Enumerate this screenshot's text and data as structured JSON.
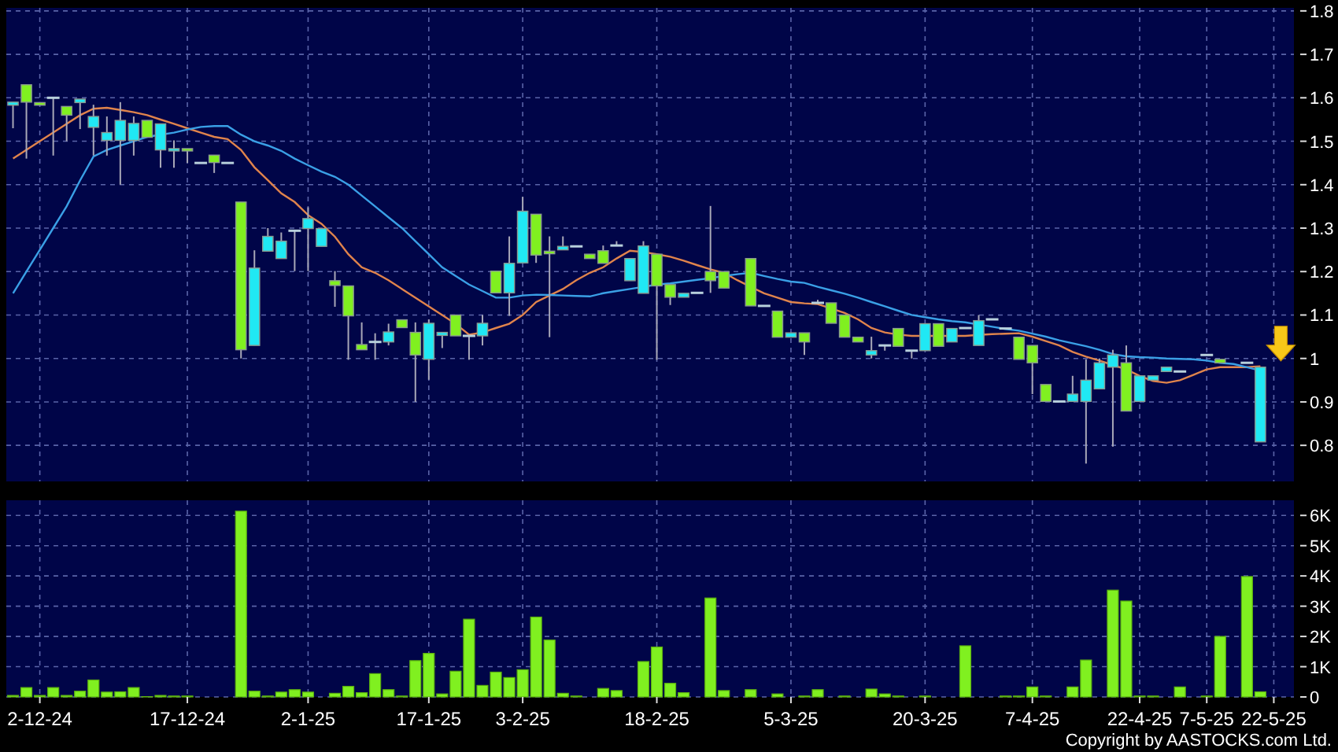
{
  "price_chart": {
    "chart_data": {
      "type": "candlestick",
      "grid": true,
      "ylim": [
        0.717,
        1.807
      ],
      "yticks": [
        0.8,
        0.9,
        1,
        1.1,
        1.2,
        1.3,
        1.4,
        1.5,
        1.6,
        1.7,
        1.8
      ],
      "categories": [
        null,
        null,
        null,
        null,
        null,
        null,
        null,
        null,
        null,
        null,
        null,
        null,
        null,
        null,
        null,
        null,
        null,
        null,
        null,
        null,
        null,
        null,
        null,
        null,
        null,
        null,
        null,
        null,
        null,
        null,
        null,
        null,
        null,
        null,
        null,
        null,
        null,
        null,
        null,
        null,
        null,
        null,
        null,
        null,
        null,
        null,
        null,
        null,
        null,
        null,
        null,
        null,
        null,
        null,
        null,
        null,
        null,
        null,
        null,
        null,
        null,
        null,
        null,
        null,
        null,
        null,
        null,
        null,
        null,
        null,
        null,
        null,
        null,
        null,
        null,
        null,
        null,
        null,
        null,
        null,
        null,
        null,
        null,
        null,
        null,
        null,
        null,
        null,
        null,
        null,
        null,
        null,
        null,
        null,
        null,
        null
      ],
      "ohlc": [
        [
          1.59,
          1.59,
          1.53,
          1.583
        ],
        [
          1.59,
          1.63,
          1.46,
          1.63
        ],
        [
          1.583,
          1.59,
          1.583,
          1.589
        ],
        [
          1.6,
          1.6,
          1.467,
          1.6
        ],
        [
          1.56,
          1.58,
          1.5,
          1.58
        ],
        [
          1.597,
          1.597,
          1.528,
          1.589
        ],
        [
          1.557,
          1.584,
          1.467,
          1.532
        ],
        [
          1.52,
          1.557,
          1.467,
          1.502
        ],
        [
          1.548,
          1.59,
          1.4,
          1.502
        ],
        [
          1.541,
          1.557,
          1.467,
          1.502
        ],
        [
          1.509,
          1.548,
          1.509,
          1.548
        ],
        [
          1.54,
          1.54,
          1.439,
          1.48
        ],
        [
          1.483,
          1.502,
          1.439,
          1.48
        ],
        [
          1.48,
          1.483,
          1.45,
          1.483
        ],
        [
          1.45,
          1.45,
          1.45,
          1.45
        ],
        [
          1.451,
          1.468,
          1.427,
          1.468
        ],
        [
          1.45,
          1.45,
          1.45,
          1.45
        ],
        [
          1.02,
          1.36,
          1,
          1.36
        ],
        [
          1.208,
          1.249,
          1.03,
          1.03
        ],
        [
          1.281,
          1.3,
          1.247,
          1.247
        ],
        [
          1.27,
          1.29,
          1.23,
          1.23
        ],
        [
          1.294,
          1.294,
          1.201,
          1.294
        ],
        [
          1.322,
          1.348,
          1.201,
          1.299
        ],
        [
          1.299,
          1.299,
          1.258,
          1.258
        ],
        [
          1.168,
          1.201,
          1.119,
          1.179
        ],
        [
          1.098,
          1.167,
          0.997,
          1.167
        ],
        [
          1.02,
          1.083,
          1.02,
          1.032
        ],
        [
          1.038,
          1.058,
          0.997,
          1.038
        ],
        [
          1.061,
          1.08,
          1.03,
          1.038
        ],
        [
          1.071,
          1.089,
          1.071,
          1.089
        ],
        [
          1.008,
          1.083,
          0.9,
          1.06
        ],
        [
          1.081,
          1.09,
          0.951,
          0.998
        ],
        [
          1.06,
          1.06,
          1.024,
          1.053
        ],
        [
          1.052,
          1.1,
          1.052,
          1.1
        ],
        [
          1.052,
          1.052,
          0.997,
          1.052
        ],
        [
          1.081,
          1.1,
          1.03,
          1.052
        ],
        [
          1.151,
          1.201,
          1.151,
          1.201
        ],
        [
          1.219,
          1.281,
          1.098,
          1.151
        ],
        [
          1.339,
          1.372,
          1.22,
          1.22
        ],
        [
          1.238,
          1.332,
          1.22,
          1.332
        ],
        [
          1.241,
          1.281,
          1.049,
          1.247
        ],
        [
          1.258,
          1.281,
          1.25,
          1.25
        ],
        [
          1.258,
          1.258,
          1.258,
          1.258
        ],
        [
          1.23,
          1.24,
          1.23,
          1.24
        ],
        [
          1.219,
          1.26,
          1.219,
          1.248
        ],
        [
          1.26,
          1.27,
          1.26,
          1.26
        ],
        [
          1.23,
          1.23,
          1.179,
          1.179
        ],
        [
          1.259,
          1.27,
          1.15,
          1.15
        ],
        [
          1.167,
          1.24,
          0.997,
          1.24
        ],
        [
          1.141,
          1.17,
          1.123,
          1.17
        ],
        [
          1.15,
          1.15,
          1.141,
          1.141
        ],
        [
          1.151,
          1.151,
          1.151,
          1.151
        ],
        [
          1.179,
          1.351,
          1.151,
          1.2
        ],
        [
          1.162,
          1.2,
          1.162,
          1.2
        ],
        null,
        [
          1.121,
          1.23,
          1.121,
          1.23
        ],
        [
          1.121,
          1.121,
          1.121,
          1.121
        ],
        [
          1.049,
          1.109,
          1.049,
          1.109
        ],
        [
          1.059,
          1.059,
          1.049,
          1.049
        ],
        [
          1.038,
          1.059,
          1.008,
          1.059
        ],
        [
          1.128,
          1.135,
          1.128,
          1.128
        ],
        [
          1.081,
          1.128,
          1.081,
          1.128
        ],
        [
          1.049,
          1.1,
          1.049,
          1.1
        ],
        [
          1.038,
          1.049,
          1.038,
          1.049
        ],
        [
          1.018,
          1.05,
          1,
          1.008
        ],
        [
          1.03,
          1.03,
          1.018,
          1.03
        ],
        [
          1.028,
          1.069,
          1.028,
          1.069
        ],
        [
          1.018,
          1.018,
          1,
          1.018
        ],
        [
          1.08,
          1.08,
          1.018,
          1.018
        ],
        [
          1.028,
          1.08,
          1.028,
          1.08
        ],
        [
          1.069,
          1.069,
          1.038,
          1.038
        ],
        [
          1.07,
          1.07,
          1.07,
          1.07
        ],
        [
          1.087,
          1.1,
          1.03,
          1.03
        ],
        [
          1.09,
          1.09,
          1.09,
          1.09
        ],
        [
          1.069,
          1.069,
          1.069,
          1.069
        ],
        [
          0.998,
          1.049,
          0.998,
          1.049
        ],
        [
          0.99,
          1.03,
          0.918,
          1.03
        ],
        [
          0.901,
          0.94,
          0.901,
          0.94
        ],
        [
          0.901,
          0.901,
          0.901,
          0.901
        ],
        [
          0.918,
          0.96,
          0.901,
          0.901
        ],
        [
          0.95,
          0.998,
          0.758,
          0.901
        ],
        [
          0.99,
          1,
          0.93,
          0.93
        ],
        [
          1.008,
          1.02,
          0.797,
          0.98
        ],
        [
          0.879,
          1.03,
          0.879,
          0.99
        ],
        [
          0.96,
          0.96,
          0.901,
          0.901
        ],
        [
          0.96,
          0.96,
          0.95,
          0.95
        ],
        [
          0.98,
          0.98,
          0.97,
          0.97
        ],
        [
          0.97,
          0.97,
          0.97,
          0.97
        ],
        null,
        [
          1.008,
          1.008,
          1.008,
          1.008
        ],
        [
          0.99,
          0.998,
          0.99,
          0.998
        ],
        null,
        [
          0.99,
          0.99,
          0.99,
          0.99
        ],
        [
          0.98,
          0.98,
          0.808,
          0.808
        ],
        null,
        null
      ],
      "series": [
        {
          "type": "line",
          "color": "#e0844c",
          "values": [
            1.46,
            1.48,
            1.5,
            1.52,
            1.54,
            1.56,
            1.575,
            1.577,
            1.572,
            1.567,
            1.56,
            1.55,
            1.54,
            1.53,
            1.52,
            1.51,
            1.505,
            1.48,
            1.44,
            1.41,
            1.38,
            1.36,
            1.33,
            1.31,
            1.28,
            1.24,
            1.21,
            1.197,
            1.18,
            1.16,
            1.14,
            1.12,
            1.1,
            1.08,
            1.055,
            1.06,
            1.07,
            1.08,
            1.1,
            1.13,
            1.145,
            1.16,
            1.18,
            1.197,
            1.21,
            1.23,
            1.248,
            1.245,
            1.24,
            1.234,
            1.225,
            1.215,
            1.205,
            1.197,
            1.18,
            1.165,
            1.15,
            1.14,
            1.13,
            1.127,
            1.125,
            1.115,
            1.105,
            1.09,
            1.07,
            1.06,
            1.055,
            1.052,
            1.052,
            1.052,
            1.052,
            1.052,
            1.054,
            1.056,
            1.057,
            1.058,
            1.05,
            1.04,
            1.03,
            1.015,
            1.004,
            0.995,
            0.985,
            0.975,
            0.96,
            0.948,
            0.944,
            0.95,
            0.962,
            0.975,
            0.98,
            0.98,
            0.98,
            0.982,
            null,
            null
          ]
        },
        {
          "type": "line",
          "color": "#3aa0e6",
          "values": [
            1.15,
            1.2,
            1.25,
            1.3,
            1.35,
            1.41,
            1.465,
            1.48,
            1.49,
            1.5,
            1.51,
            1.515,
            1.52,
            1.527,
            1.533,
            1.535,
            1.535,
            1.515,
            1.5,
            1.49,
            1.478,
            1.46,
            1.445,
            1.43,
            1.418,
            1.4,
            1.375,
            1.35,
            1.325,
            1.3,
            1.27,
            1.24,
            1.21,
            1.19,
            1.17,
            1.155,
            1.14,
            1.14,
            1.145,
            1.147,
            1.146,
            1.145,
            1.144,
            1.143,
            1.15,
            1.155,
            1.16,
            1.165,
            1.17,
            1.173,
            1.177,
            1.181,
            1.185,
            1.19,
            1.194,
            1.197,
            1.19,
            1.183,
            1.177,
            1.174,
            1.165,
            1.157,
            1.149,
            1.14,
            1.13,
            1.12,
            1.11,
            1.1,
            1.095,
            1.09,
            1.086,
            1.083,
            1.078,
            1.073,
            1.068,
            1.064,
            1.057,
            1.05,
            1.042,
            1.035,
            1.028,
            1.02,
            1.01,
            1.005,
            1.003,
            1.002,
            1,
            0.999,
            0.998,
            0.995,
            0.99,
            0.987,
            0.98,
            0.972,
            null,
            null
          ]
        }
      ]
    }
  },
  "volume_chart": {
    "chart_data": {
      "type": "bar",
      "grid": true,
      "ylim": [
        0,
        6500
      ],
      "categories": [
        null,
        null,
        "2-12-24",
        null,
        null,
        null,
        null,
        null,
        null,
        null,
        null,
        null,
        null,
        "17-12-24",
        null,
        null,
        null,
        null,
        null,
        null,
        null,
        null,
        "2-1-25",
        null,
        null,
        null,
        null,
        null,
        null,
        null,
        null,
        "17-1-25",
        null,
        null,
        null,
        null,
        null,
        null,
        "3-2-25",
        null,
        null,
        null,
        null,
        null,
        null,
        null,
        null,
        null,
        "18-2-25",
        null,
        null,
        null,
        null,
        null,
        null,
        null,
        null,
        null,
        "5-3-25",
        null,
        null,
        null,
        null,
        null,
        null,
        null,
        null,
        null,
        "20-3-25",
        null,
        null,
        null,
        null,
        null,
        null,
        null,
        "7-4-25",
        null,
        null,
        null,
        null,
        null,
        null,
        null,
        "22-4-25",
        null,
        null,
        null,
        null,
        "7-5-25",
        null,
        null,
        null,
        null,
        "22-5-25",
        null
      ],
      "yticks": [
        {
          "value": 0,
          "label": "0"
        },
        {
          "value": 1000,
          "label": "1K"
        },
        {
          "value": 2000,
          "label": "2K"
        },
        {
          "value": 3000,
          "label": "3K"
        },
        {
          "value": 4000,
          "label": "4K"
        },
        {
          "value": 5000,
          "label": "5K"
        },
        {
          "value": 6000,
          "label": "6K"
        }
      ],
      "values": [
        50,
        310,
        50,
        310,
        50,
        190,
        560,
        160,
        170,
        310,
        10,
        50,
        30,
        30,
        0,
        0,
        0,
        6140,
        190,
        30,
        160,
        240,
        160,
        0,
        120,
        350,
        140,
        770,
        240,
        30,
        1200,
        1440,
        100,
        850,
        2570,
        380,
        820,
        640,
        900,
        2640,
        1880,
        120,
        30,
        0,
        280,
        210,
        0,
        1170,
        1650,
        450,
        140,
        0,
        3270,
        210,
        0,
        240,
        0,
        100,
        0,
        30,
        240,
        0,
        30,
        0,
        260,
        100,
        30,
        0,
        30,
        0,
        0,
        1690,
        0,
        0,
        30,
        30,
        330,
        30,
        0,
        330,
        1220,
        0,
        3530,
        3170,
        30,
        30,
        0,
        330,
        0,
        30,
        2000,
        0,
        3980,
        170,
        null,
        null
      ]
    }
  },
  "copyright": "Copyright by AASTOCKS.com Ltd."
}
